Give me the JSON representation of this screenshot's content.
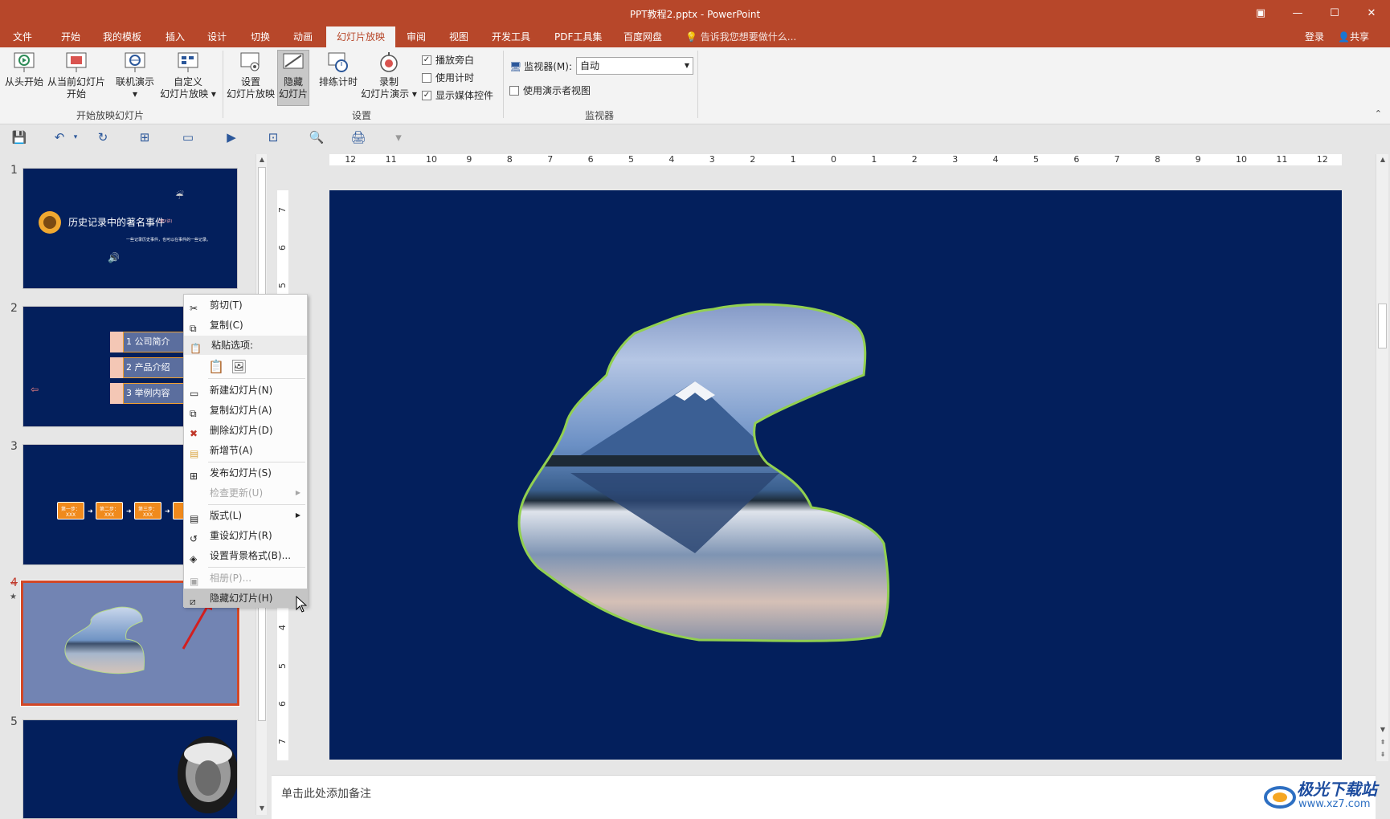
{
  "window": {
    "title": "PPT教程2.pptx - PowerPoint",
    "restore_icon": "ribbon-display-options-icon",
    "min_icon": "minimize-icon",
    "max_icon": "maximize-icon",
    "close_icon": "close-icon"
  },
  "tabs": [
    "文件",
    "开始",
    "我的模板",
    "插入",
    "设计",
    "切换",
    "动画",
    "幻灯片放映",
    "审阅",
    "视图",
    "开发工具",
    "PDF工具集",
    "百度网盘"
  ],
  "active_tab": "幻灯片放映",
  "tell_me": "告诉我您想要做什么...",
  "login": "登录",
  "share": "共享",
  "ribbon": {
    "from_beginning": "从头开始",
    "from_current_1": "从当前幻灯片",
    "from_current_2": "开始",
    "online_present": "联机演示",
    "custom_1": "自定义",
    "custom_2": "幻灯片放映",
    "group_start": "开始放映幻灯片",
    "setup_1": "设置",
    "setup_2": "幻灯片放映",
    "hide_1": "隐藏",
    "hide_2": "幻灯片",
    "rehearse": "排练计时",
    "record_1": "录制",
    "record_2": "幻灯片演示",
    "play_narrations": "播放旁白",
    "use_timings": "使用计时",
    "show_media": "显示媒体控件",
    "group_setup": "设置",
    "monitor_label": "监视器(M):",
    "monitor_value": "自动",
    "presenter_view": "使用演示者视图",
    "group_monitors": "监视器"
  },
  "checks": {
    "play_narrations": true,
    "use_timings": false,
    "show_media": true,
    "presenter_view": false
  },
  "slides": [
    {
      "num": "1",
      "title": "历史记录中的著名事件",
      "title_tag": "(第X讲)",
      "subtitle": "一些记录历史事件，也可以在事件的一些记录。"
    },
    {
      "num": "2",
      "items": [
        "1 公司简介",
        "2 产品介绍",
        "3 举例内容"
      ]
    },
    {
      "num": "3",
      "steps": [
        "第一步：",
        "第二步：",
        "第三步："
      ],
      "step_sub": "XXX"
    },
    {
      "num": "4"
    },
    {
      "num": "5"
    }
  ],
  "context_menu": {
    "cut": "剪切(T)",
    "copy": "复制(C)",
    "paste_options": "粘贴选项:",
    "new_slide": "新建幻灯片(N)",
    "duplicate": "复制幻灯片(A)",
    "delete": "删除幻灯片(D)",
    "new_section": "新增节(A)",
    "publish": "发布幻灯片(S)",
    "check_updates": "检查更新(U)",
    "layout": "版式(L)",
    "reset": "重设幻灯片(R)",
    "format_bg": "设置背景格式(B)...",
    "photo_album": "相册(P)...",
    "hide_slide": "隐藏幻灯片(H)"
  },
  "ruler": {
    "h": [
      "12",
      "11",
      "10",
      "9",
      "8",
      "7",
      "6",
      "5",
      "4",
      "3",
      "2",
      "1",
      "0",
      "1",
      "2",
      "3",
      "4",
      "5",
      "6",
      "7",
      "8",
      "9",
      "10",
      "11",
      "12"
    ],
    "v": [
      "7",
      "6",
      "5",
      "4",
      "3",
      "2",
      "1",
      "0",
      "1",
      "2",
      "3",
      "4",
      "5",
      "6",
      "7"
    ]
  },
  "notes_placeholder": "单击此处添加备注",
  "watermark": {
    "line1": "极光下载站",
    "line2": "www.xz7.com"
  },
  "colors": {
    "accent": "#b7472a",
    "slide_bg": "#031f5c",
    "selection": "#d24726"
  }
}
